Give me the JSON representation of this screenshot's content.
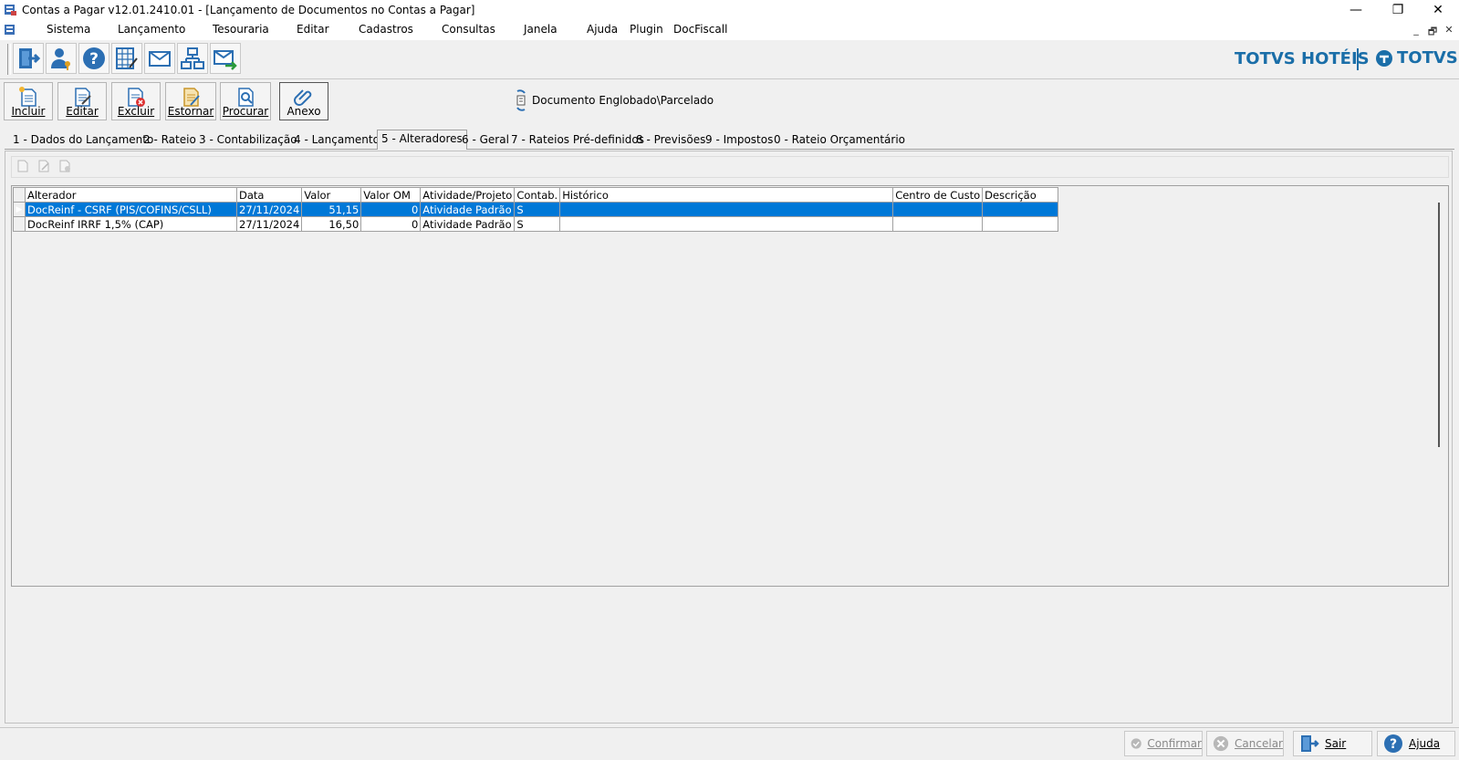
{
  "window": {
    "title": "Contas a Pagar v12.01.2410.01 - [Lançamento de Documentos no Contas a Pagar]",
    "controls": {
      "minimize": "—",
      "maximize": "❐",
      "close": "✕"
    },
    "mdi": {
      "minimize": "_",
      "restore": "🗗",
      "close": "✕"
    }
  },
  "menu": [
    "Sistema",
    "Lançamento",
    "Tesouraria",
    "Editar",
    "Cadastros",
    "Consultas",
    "Janela",
    "Ajuda",
    "Plugin",
    "DocFiscall"
  ],
  "brand": {
    "left": "TOTVS HOTÉIS",
    "right": "TOTVS"
  },
  "actions": {
    "incluir": "Incluir",
    "editar": "Editar",
    "excluir": "Excluir",
    "estornar": "Estornar",
    "procurar": "Procurar",
    "anexo": "Anexo"
  },
  "doc_englobado": "Documento Englobado\\Parcelado",
  "tabs": [
    "1 - Dados do Lançamento",
    "2 - Rateio",
    "3 - Contabilização",
    "4 - Lançamentos",
    "5 - Alteradores",
    "6 - Geral",
    "7 - Rateios Pré-definidos",
    "8 - Previsões",
    "9 - Impostos",
    "0 - Rateio Orçamentário"
  ],
  "active_tab": "5 - Alteradores",
  "grid": {
    "columns": [
      "Alterador",
      "Data",
      "Valor",
      "Valor OM",
      "Atividade/Projeto",
      "Contab.",
      "Histórico",
      "Centro de Custo",
      "Descrição"
    ],
    "rows": [
      [
        "DocReinf - CSRF (PIS/COFINS/CSLL)",
        "27/11/2024",
        "51,15",
        "0",
        "Atividade Padrão",
        "S",
        "",
        "",
        ""
      ],
      [
        "DocReinf IRRF 1,5% (CAP)",
        "27/11/2024",
        "16,50",
        "0",
        "Atividade Padrão",
        "S",
        "",
        "",
        ""
      ]
    ],
    "selected_row": 0
  },
  "bottom": {
    "confirmar": "Confirmar",
    "cancelar": "Cancelar",
    "sair": "Sair",
    "ajuda": "Ajuda"
  },
  "colors": {
    "selection": "#0078d7",
    "brand": "#1a6ea8"
  }
}
